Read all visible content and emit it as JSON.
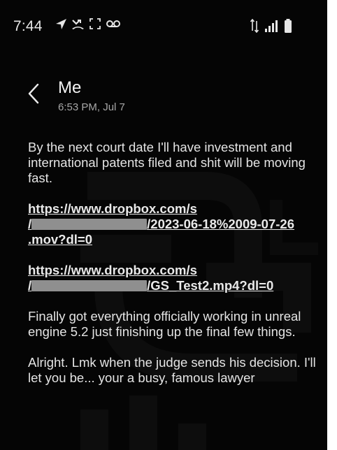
{
  "status_bar": {
    "time": "7:44",
    "left_icons": [
      "navigation-arrow-icon",
      "missed-call-icon",
      "screenshot-icon",
      "voicemail-icon"
    ],
    "right_icons": [
      "data-arrows-icon",
      "signal-icon",
      "battery-icon"
    ]
  },
  "header": {
    "title": "Me",
    "subtitle": "6:53 PM, Jul 7"
  },
  "messages": [
    "By the next court date I'll have investment and international patents filed and shit will be moving fast.",
    "Finally got everything officially working in unreal engine 5.2 just finishing up the final few things.",
    "Alright. Lmk when the judge sends his decision. I'll let you be... your a busy, famous lawyer"
  ],
  "links": {
    "link1_line1": "https://www.dropbox.com/s",
    "link1_line2_prefix": "/",
    "link1_line2_suffix": "/2023-06-18%2009-07-26",
    "link1_line3": ".mov?dl=0",
    "link2_line1": "https://www.dropbox.com/s",
    "link2_line2_prefix": "/",
    "link2_line2_suffix": "/GS_Test2.mp4?dl=0"
  },
  "colors": {
    "background": "#050505",
    "text": "#e4e4e4",
    "redaction": "#8f8f8f"
  }
}
